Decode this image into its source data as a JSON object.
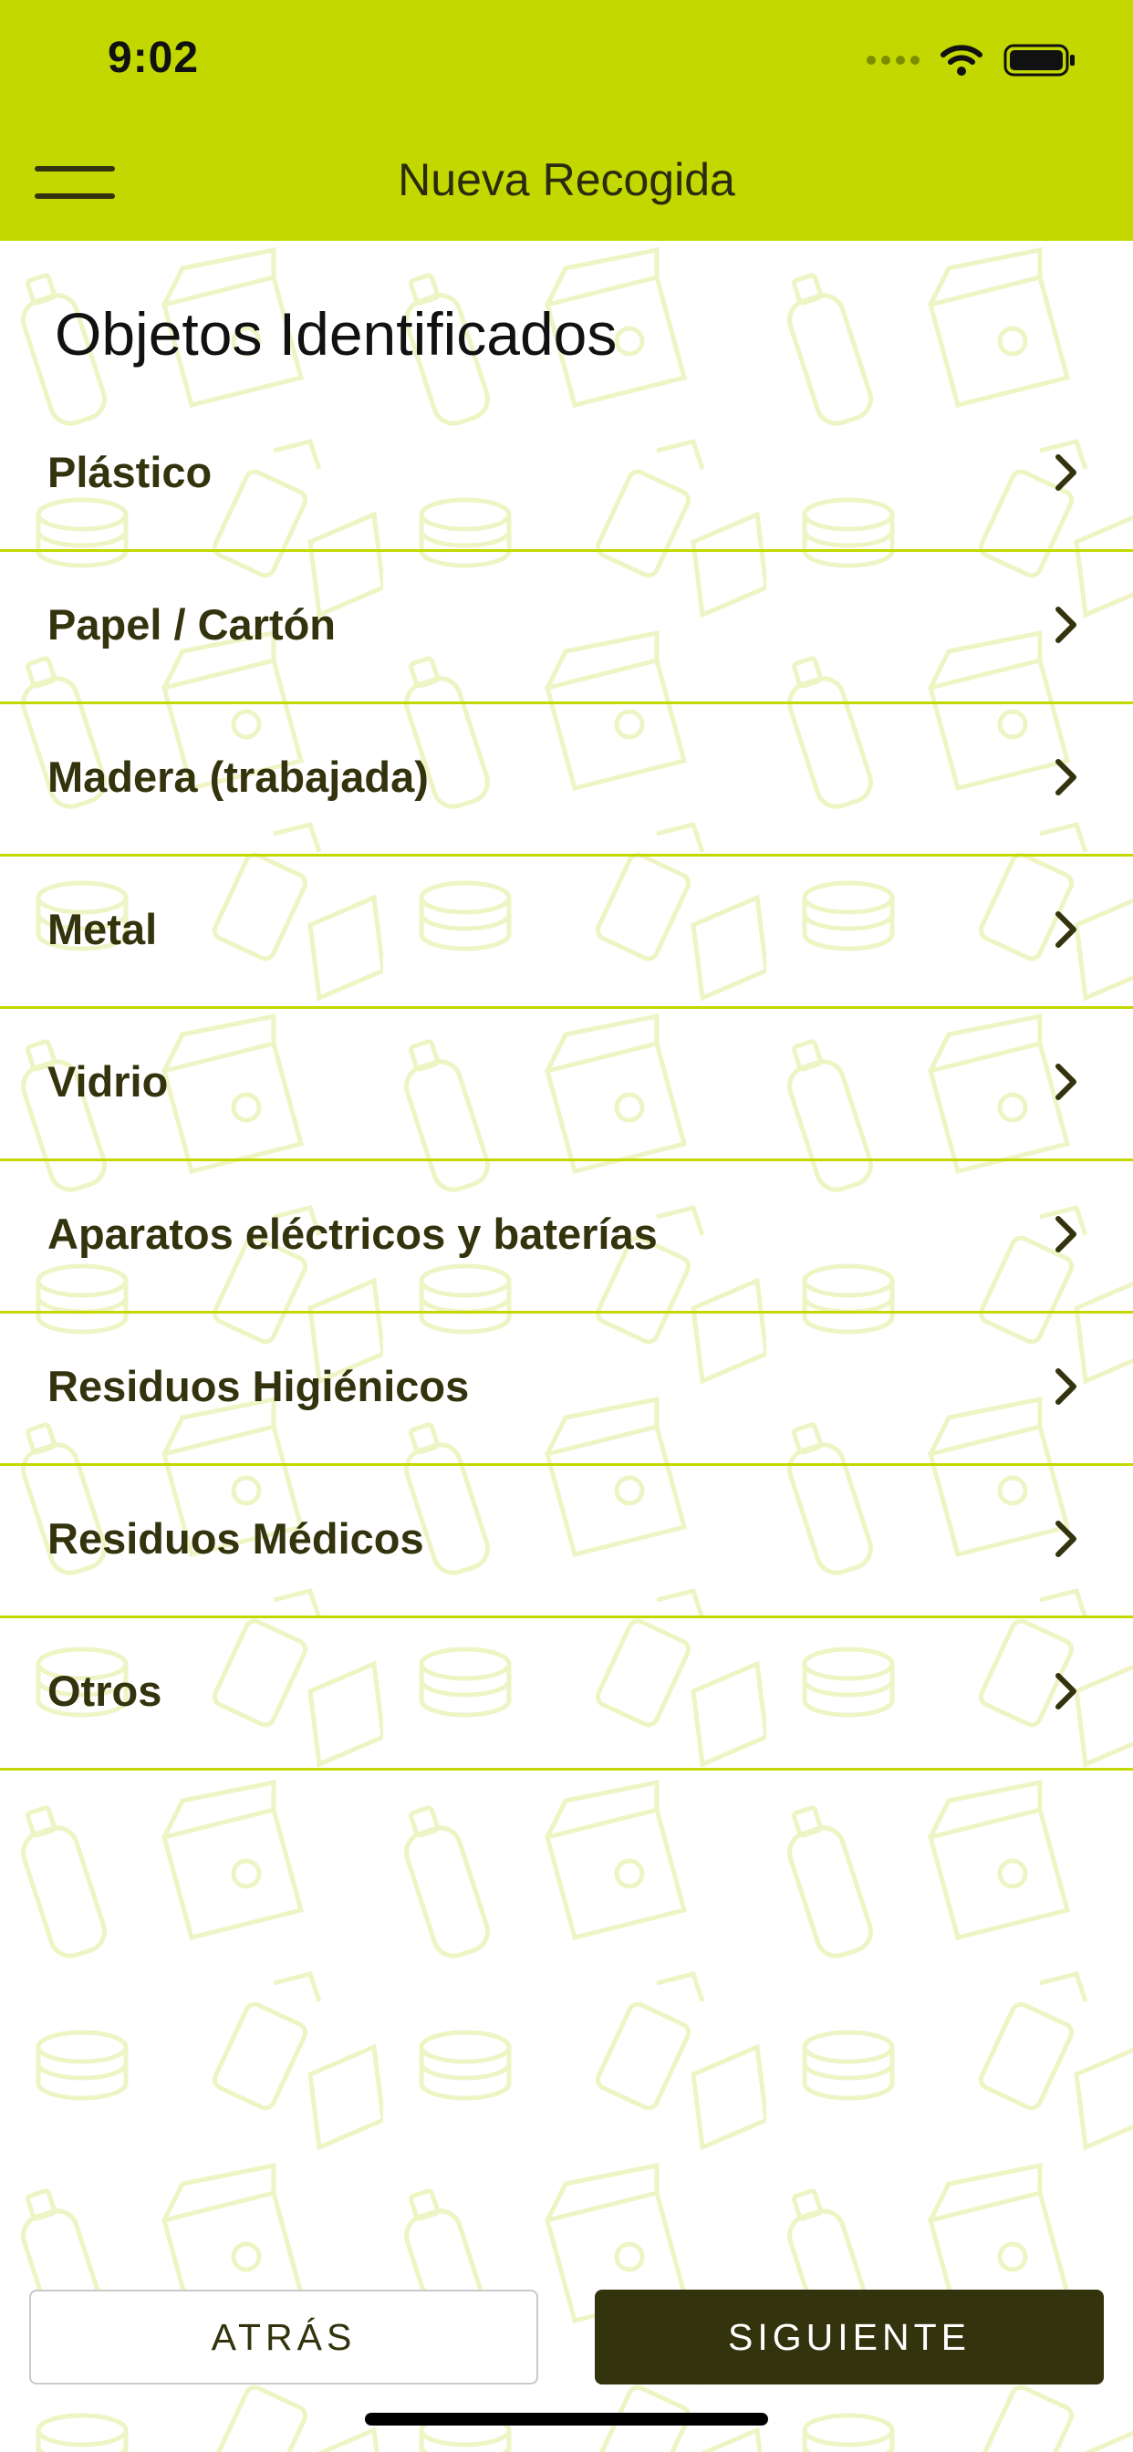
{
  "status_bar": {
    "time": "9:02",
    "icons": [
      "signal-dots-icon",
      "wifi-icon",
      "battery-icon"
    ]
  },
  "nav_bar": {
    "title": "Nueva Recogida",
    "menu_icon": "hamburger-menu-icon"
  },
  "section": {
    "title": "Objetos Identificados"
  },
  "categories": [
    {
      "label": "Plástico"
    },
    {
      "label": "Papel / Cartón"
    },
    {
      "label": "Madera (trabajada)"
    },
    {
      "label": "Metal"
    },
    {
      "label": "Vidrio"
    },
    {
      "label": "Aparatos eléctricos y baterías"
    },
    {
      "label": "Residuos Higiénicos"
    },
    {
      "label": "Residuos Médicos"
    },
    {
      "label": "Otros"
    }
  ],
  "buttons": {
    "back_label": "ATRÁS",
    "next_label": "SIGUIENTE"
  },
  "colors": {
    "accent": "#c2d800",
    "dark": "#33330d",
    "pattern": "#f4f8d6"
  }
}
